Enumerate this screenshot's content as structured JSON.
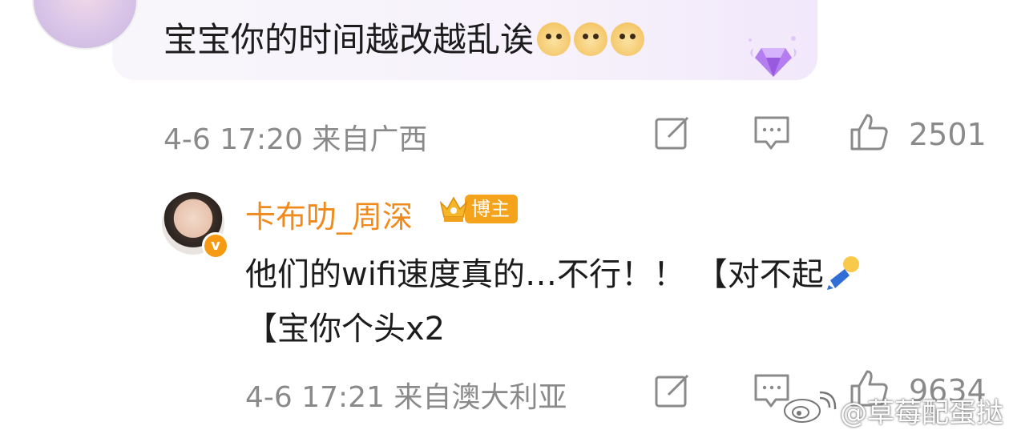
{
  "top_comment": {
    "text": "宝宝你的时间越改越乱诶",
    "emoji_count": 3,
    "meta": "4-6 17:20 来自广西",
    "like_count": "2501"
  },
  "reply": {
    "username": "卡布叻_周深",
    "badge": "博主",
    "verified_mark": "v",
    "text_line1": "他们的wifi速度真的…不行！！ 【对不起",
    "text_line2": "【宝你个头x2",
    "meta": "4-6 17:21 来自澳大利亚",
    "like_count": "9634"
  },
  "watermark": {
    "text": "@草莓配蛋挞"
  },
  "icons": {
    "share": "share-edit-icon",
    "comment": "comment-bubble-icon",
    "like": "thumbs-up-icon",
    "emoji_doge": "doge-emoji",
    "gem": "diamond-badge-icon",
    "crown": "crown-icon",
    "sorry_emoji": "bowing-person-emoji",
    "weibo": "weibo-logo-icon"
  },
  "colors": {
    "username": "#f08a1c",
    "meta_gray": "#8a8a8a",
    "badge_orange": "#f5a31a",
    "gem_purple": "#a86de8"
  }
}
